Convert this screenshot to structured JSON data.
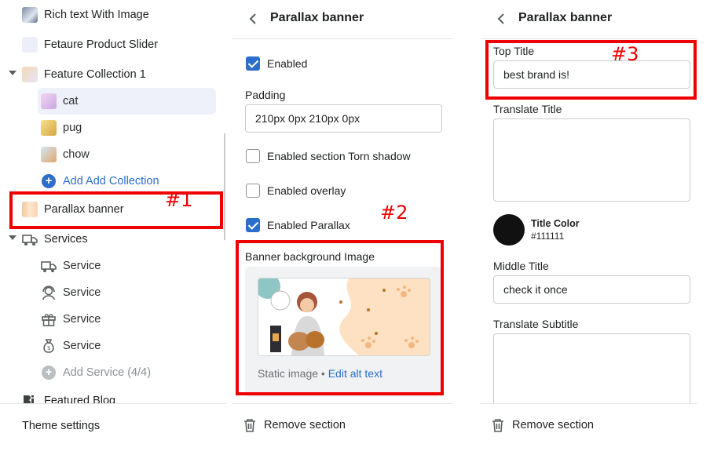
{
  "sidebar": {
    "items": [
      {
        "label": "Rich text With Image"
      },
      {
        "label": "Fetaure Product Slider"
      },
      {
        "label": "Feature Collection 1"
      },
      {
        "label": "cat"
      },
      {
        "label": "pug"
      },
      {
        "label": "chow"
      },
      {
        "label": "Add Add Collection"
      },
      {
        "label": "Parallax banner"
      },
      {
        "label": "Services"
      },
      {
        "label": "Service"
      },
      {
        "label": "Service"
      },
      {
        "label": "Service"
      },
      {
        "label": "Service"
      },
      {
        "label": "Add Service (4/4)"
      },
      {
        "label": "Featured Blog"
      }
    ],
    "footer_label": "Theme settings"
  },
  "middle_panel": {
    "title": "Parallax banner",
    "enabled_label": "Enabled",
    "enabled_checked": true,
    "padding_label": "Padding",
    "padding_value": "210px 0px 210px 0px",
    "torn_shadow_label": "Enabled section Torn shadow",
    "torn_shadow_checked": false,
    "overlay_label": "Enabled overlay",
    "overlay_checked": false,
    "parallax_label": "Enabled Parallax",
    "parallax_checked": true,
    "bg_image_label": "Banner background Image",
    "image_caption": "Static image •",
    "alt_text_link": "Edit alt text",
    "remove_label": "Remove section"
  },
  "right_panel": {
    "title": "Parallax banner",
    "top_title_label": "Top Title",
    "top_title_value": "best brand is!",
    "translate_title_label": "Translate Title",
    "translate_title_value": "",
    "title_color_label": "Title Color",
    "title_color_value": "#111111",
    "middle_title_label": "Middle Title",
    "middle_title_value": "check it once",
    "translate_subtitle_label": "Translate Subtitle",
    "translate_subtitle_value": "",
    "remove_label": "Remove section"
  },
  "annotations": [
    "#1",
    "#2",
    "#3"
  ],
  "colors": {
    "accent": "#2c6ecb",
    "annotation": "#ee0000",
    "selected_bg": "#eef1f9",
    "swatch": "#111111"
  },
  "icons": [
    "chevron-left-icon",
    "trash-icon",
    "plus-circle-icon",
    "caret-down-icon",
    "service-icon"
  ]
}
